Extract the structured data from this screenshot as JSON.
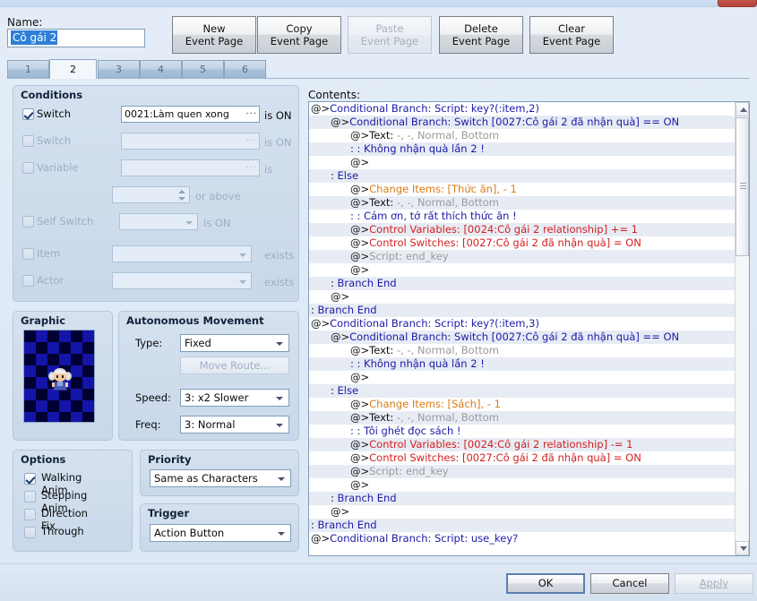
{
  "window": {
    "close_label": "✕"
  },
  "header": {
    "name_label": "Name:",
    "name_value": "Cô gái 2",
    "buttons": [
      {
        "line1": "New",
        "line2": "Event Page",
        "disabled": false
      },
      {
        "line1": "Copy",
        "line2": "Event Page",
        "disabled": false
      },
      {
        "line1": "Paste",
        "line2": "Event Page",
        "disabled": true
      },
      {
        "line1": "Delete",
        "line2": "Event Page",
        "disabled": false
      },
      {
        "line1": "Clear",
        "line2": "Event Page",
        "disabled": false
      }
    ]
  },
  "tabs": {
    "items": [
      "1",
      "2",
      "3",
      "4",
      "5",
      "6"
    ],
    "active_index": 1
  },
  "conditions": {
    "title": "Conditions",
    "rows": [
      {
        "label": "Switch",
        "checked": true,
        "value": "0021:Làm quen xong",
        "suffix": "is ON",
        "picker": "dots"
      },
      {
        "label": "Switch",
        "checked": false,
        "value": "",
        "suffix": "is ON",
        "picker": "dots"
      },
      {
        "label": "Variable",
        "checked": false,
        "value": "",
        "suffix": "is",
        "picker": "dots"
      },
      {
        "label": "",
        "checked": null,
        "value": "",
        "suffix": "or above",
        "picker": "spin"
      },
      {
        "label": "Self Switch",
        "checked": false,
        "value": "",
        "suffix": "is ON",
        "picker": "combo"
      },
      {
        "label": "Item",
        "checked": false,
        "value": "",
        "suffix": "exists",
        "picker": "combo"
      },
      {
        "label": "Actor",
        "checked": false,
        "value": "",
        "suffix": "exists",
        "picker": "combo"
      }
    ]
  },
  "graphic": {
    "title": "Graphic",
    "sprite_name": "character-sprite-girl"
  },
  "autonomous_movement": {
    "title": "Autonomous Movement",
    "type_label": "Type:",
    "type_value": "Fixed",
    "move_route_label": "Move Route...",
    "move_route_disabled": true,
    "speed_label": "Speed:",
    "speed_value": "3: x2 Slower",
    "freq_label": "Freq:",
    "freq_value": "3: Normal"
  },
  "options": {
    "title": "Options",
    "items": [
      {
        "label": "Walking Anim.",
        "checked": true
      },
      {
        "label": "Stepping Anim.",
        "checked": false
      },
      {
        "label": "Direction Fix",
        "checked": false
      },
      {
        "label": "Through",
        "checked": false
      }
    ]
  },
  "priority": {
    "title": "Priority",
    "value": "Same as Characters"
  },
  "trigger": {
    "title": "Trigger",
    "value": "Action Button"
  },
  "contents": {
    "label": "Contents:",
    "rows": [
      {
        "indent": 0,
        "segments": [
          {
            "t": "@>",
            "c": "dark"
          },
          {
            "t": "Conditional Branch: Script: key?(:item,2)",
            "c": "blue"
          }
        ]
      },
      {
        "indent": 1,
        "segments": [
          {
            "t": "@>",
            "c": "dark"
          },
          {
            "t": "Conditional Branch: Switch [0027:Cô gái 2 đã nhận quà] == ON",
            "c": "blue"
          }
        ]
      },
      {
        "indent": 2,
        "segments": [
          {
            "t": "@>",
            "c": "dark"
          },
          {
            "t": "Text: ",
            "c": "dark"
          },
          {
            "t": "-, -, Normal, Bottom",
            "c": "gray"
          }
        ]
      },
      {
        "indent": 2,
        "segments": [
          {
            "t": ":      : Không nhận quà lần 2 !",
            "c": "blue"
          }
        ]
      },
      {
        "indent": 2,
        "segments": [
          {
            "t": "@>",
            "c": "dark"
          }
        ]
      },
      {
        "indent": 1,
        "segments": [
          {
            "t": ":  ",
            "c": "dark"
          },
          {
            "t": "Else",
            "c": "blue"
          }
        ]
      },
      {
        "indent": 2,
        "segments": [
          {
            "t": "@>",
            "c": "dark"
          },
          {
            "t": "Change Items: [Thức ăn], - 1",
            "c": "orange"
          }
        ]
      },
      {
        "indent": 2,
        "segments": [
          {
            "t": "@>",
            "c": "dark"
          },
          {
            "t": "Text: ",
            "c": "dark"
          },
          {
            "t": "-, -, Normal, Bottom",
            "c": "gray"
          }
        ]
      },
      {
        "indent": 2,
        "segments": [
          {
            "t": ":      : Cảm ơn, tớ rất thích thức ăn !",
            "c": "blue"
          }
        ]
      },
      {
        "indent": 2,
        "segments": [
          {
            "t": "@>",
            "c": "dark"
          },
          {
            "t": "Control Variables: [0024:Cô gái 2 relationship] += 1",
            "c": "red"
          }
        ]
      },
      {
        "indent": 2,
        "segments": [
          {
            "t": "@>",
            "c": "dark"
          },
          {
            "t": "Control Switches: [0027:Cô gái 2 đã nhận quà] = ON",
            "c": "red"
          }
        ]
      },
      {
        "indent": 2,
        "segments": [
          {
            "t": "@>",
            "c": "dark"
          },
          {
            "t": "Script: end_key",
            "c": "gray"
          }
        ]
      },
      {
        "indent": 2,
        "segments": [
          {
            "t": "@>",
            "c": "dark"
          }
        ]
      },
      {
        "indent": 1,
        "segments": [
          {
            "t": ":  ",
            "c": "dark"
          },
          {
            "t": "Branch End",
            "c": "blue"
          }
        ]
      },
      {
        "indent": 1,
        "segments": [
          {
            "t": "@>",
            "c": "dark"
          }
        ]
      },
      {
        "indent": 0,
        "segments": [
          {
            "t": ":  ",
            "c": "dark"
          },
          {
            "t": "Branch End",
            "c": "blue"
          }
        ]
      },
      {
        "indent": 0,
        "segments": [
          {
            "t": "@>",
            "c": "dark"
          },
          {
            "t": "Conditional Branch: Script: key?(:item,3)",
            "c": "blue"
          }
        ]
      },
      {
        "indent": 1,
        "segments": [
          {
            "t": "@>",
            "c": "dark"
          },
          {
            "t": "Conditional Branch: Switch [0027:Cô gái 2 đã nhận quà] == ON",
            "c": "blue"
          }
        ]
      },
      {
        "indent": 2,
        "segments": [
          {
            "t": "@>",
            "c": "dark"
          },
          {
            "t": "Text: ",
            "c": "dark"
          },
          {
            "t": "-, -, Normal, Bottom",
            "c": "gray"
          }
        ]
      },
      {
        "indent": 2,
        "segments": [
          {
            "t": ":      : Không nhận quà lần 2 !",
            "c": "blue"
          }
        ]
      },
      {
        "indent": 2,
        "segments": [
          {
            "t": "@>",
            "c": "dark"
          }
        ]
      },
      {
        "indent": 1,
        "segments": [
          {
            "t": ":  ",
            "c": "dark"
          },
          {
            "t": "Else",
            "c": "blue"
          }
        ]
      },
      {
        "indent": 2,
        "segments": [
          {
            "t": "@>",
            "c": "dark"
          },
          {
            "t": "Change Items: [Sách], - 1",
            "c": "orange"
          }
        ]
      },
      {
        "indent": 2,
        "segments": [
          {
            "t": "@>",
            "c": "dark"
          },
          {
            "t": "Text: ",
            "c": "dark"
          },
          {
            "t": "-, -, Normal, Bottom",
            "c": "gray"
          }
        ]
      },
      {
        "indent": 2,
        "segments": [
          {
            "t": ":      : Tôi ghét đọc sách !",
            "c": "blue"
          }
        ]
      },
      {
        "indent": 2,
        "segments": [
          {
            "t": "@>",
            "c": "dark"
          },
          {
            "t": "Control Variables: [0024:Cô gái 2 relationship] -= 1",
            "c": "red"
          }
        ]
      },
      {
        "indent": 2,
        "segments": [
          {
            "t": "@>",
            "c": "dark"
          },
          {
            "t": "Control Switches: [0027:Cô gái 2 đã nhận quà] = ON",
            "c": "red"
          }
        ]
      },
      {
        "indent": 2,
        "segments": [
          {
            "t": "@>",
            "c": "dark"
          },
          {
            "t": "Script: end_key",
            "c": "gray"
          }
        ]
      },
      {
        "indent": 2,
        "segments": [
          {
            "t": "@>",
            "c": "dark"
          }
        ]
      },
      {
        "indent": 1,
        "segments": [
          {
            "t": ":  ",
            "c": "dark"
          },
          {
            "t": "Branch End",
            "c": "blue"
          }
        ]
      },
      {
        "indent": 1,
        "segments": [
          {
            "t": "@>",
            "c": "dark"
          }
        ]
      },
      {
        "indent": 0,
        "segments": [
          {
            "t": ":  ",
            "c": "dark"
          },
          {
            "t": "Branch End",
            "c": "blue"
          }
        ]
      },
      {
        "indent": 0,
        "segments": [
          {
            "t": "@>",
            "c": "dark"
          },
          {
            "t": "Conditional Branch: Script: use_key?",
            "c": "blue"
          }
        ]
      }
    ]
  },
  "footer": {
    "ok_label": "OK",
    "cancel_label": "Cancel",
    "apply_label": "Apply",
    "apply_disabled": true
  },
  "colors": {
    "accent_blue": "#1a1aa8",
    "accent_red": "#d32020",
    "accent_orange": "#d97b17",
    "selection": "#2f7fd8",
    "panel": "#cdd9ea"
  }
}
